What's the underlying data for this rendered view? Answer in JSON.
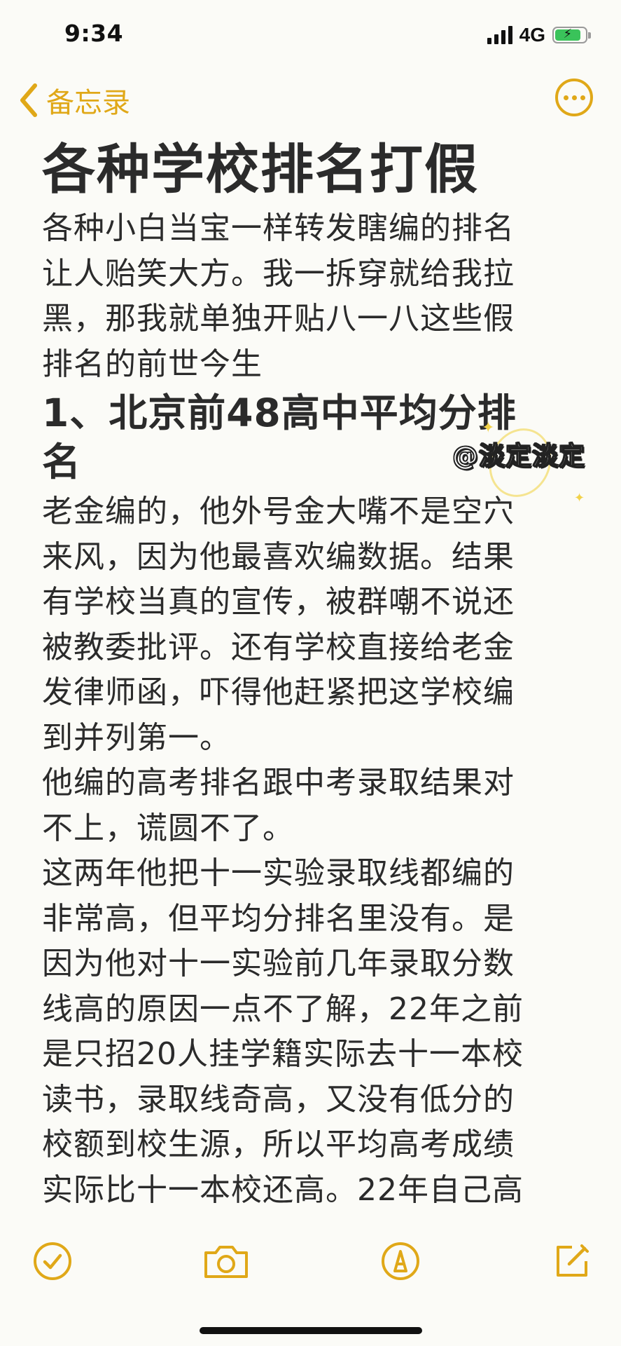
{
  "status_bar": {
    "time": "9:34",
    "network": "4G",
    "battery_charging": true,
    "battery_level_fraction": 0.85
  },
  "nav": {
    "back_label": "备忘录",
    "back_icon": "chevron-left-icon",
    "more_icon": "ellipsis-circle-icon",
    "accent_color": "#e0a818"
  },
  "note": {
    "title": "各种学校排名打假",
    "intro_lines": [
      "各种小白当宝一样转发瞎编的排名",
      "让人贻笑大方。我一拆穿就给我拉",
      "黑，那我就单独开贴八一八这些假",
      "排名的前世今生"
    ],
    "section1_heading_lines": [
      "1、北京前48高中平均分排",
      "名"
    ],
    "section1_body_lines": [
      "老金编的，他外号金大嘴不是空穴",
      "来风，因为他最喜欢编数据。结果",
      "有学校当真的宣传，被群嘲不说还",
      "被教委批评。还有学校直接给老金",
      "发律师函，吓得他赶紧把这学校编",
      "到并列第一。",
      "他编的高考排名跟中考录取结果对",
      "不上，谎圆不了。",
      "这两年他把十一实验录取线都编的",
      "非常高，但平均分排名里没有。是",
      "因为他对十一实验前几年录取分数",
      "线高的原因一点不了解，22年之前",
      "是只招20人挂学籍实际去十一本校",
      "读书，录取线奇高，又没有低分的",
      "校额到校生源，所以平均高考成绩",
      "实际比十一本校还高。22年自己高"
    ]
  },
  "watermark": {
    "text": "@淡定淡定"
  },
  "toolbar": {
    "checklist_icon": "checkmark-circle-icon",
    "camera_icon": "camera-icon",
    "markup_icon": "pen-circle-icon",
    "compose_icon": "compose-icon"
  }
}
